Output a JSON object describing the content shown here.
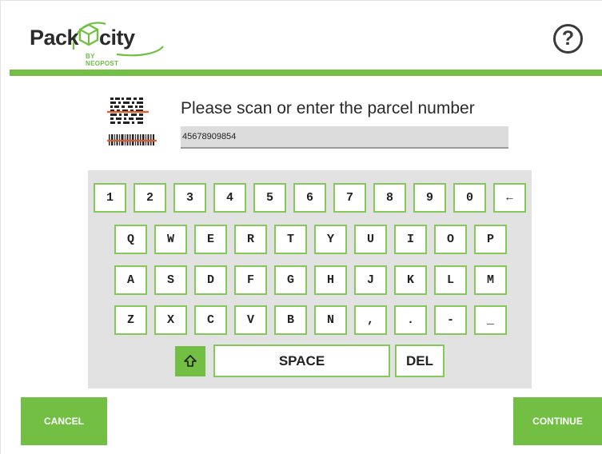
{
  "header": {
    "logo_pack": "Pack",
    "logo_city": "city",
    "logo_sub": "BY NEOPOST",
    "help_label": "?"
  },
  "scan": {
    "prompt": "Please scan or enter the parcel number",
    "parcel_number": "45678909854",
    "icon": "barcode-scan-icon"
  },
  "keyboard": {
    "row1": [
      "1",
      "2",
      "3",
      "4",
      "5",
      "6",
      "7",
      "8",
      "9",
      "0",
      "←"
    ],
    "row2": [
      "Q",
      "W",
      "E",
      "R",
      "T",
      "Y",
      "U",
      "I",
      "O",
      "P"
    ],
    "row3": [
      "A",
      "S",
      "D",
      "F",
      "G",
      "H",
      "J",
      "K",
      "L",
      "M"
    ],
    "row4": [
      "Z",
      "X",
      "C",
      "V",
      "B",
      "N",
      ",",
      ".",
      "-",
      "_"
    ],
    "shift_icon": "shift-arrow-icon",
    "space_label": "SPACE",
    "del_label": "DEL"
  },
  "buttons": {
    "cancel": "CANCEL",
    "continue": "CONTINUE"
  },
  "colors": {
    "accent": "#72bf44",
    "key_border": "#85c95a",
    "keyboard_bg": "#e2e2e2"
  }
}
